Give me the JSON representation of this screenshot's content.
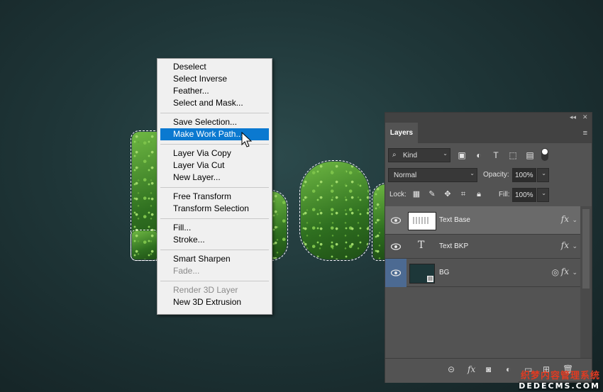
{
  "canvas_text": "Leaf",
  "context_menu": {
    "items": [
      {
        "label": "Deselect",
        "disabled": false
      },
      {
        "label": "Select Inverse",
        "disabled": false
      },
      {
        "label": "Feather...",
        "disabled": false
      },
      {
        "label": "Select and Mask...",
        "disabled": false
      },
      {
        "label": "Save Selection...",
        "disabled": false
      },
      {
        "label": "Make Work Path...",
        "disabled": false,
        "selected": true
      },
      {
        "label": "Layer Via Copy",
        "disabled": false
      },
      {
        "label": "Layer Via Cut",
        "disabled": false
      },
      {
        "label": "New Layer...",
        "disabled": false
      },
      {
        "label": "Free Transform",
        "disabled": false
      },
      {
        "label": "Transform Selection",
        "disabled": false
      },
      {
        "label": "Fill...",
        "disabled": false
      },
      {
        "label": "Stroke...",
        "disabled": false
      },
      {
        "label": "Smart Sharpen",
        "disabled": false
      },
      {
        "label": "Fade...",
        "disabled": true
      },
      {
        "label": "Render 3D Layer",
        "disabled": true
      },
      {
        "label": "New 3D Extrusion",
        "disabled": false
      }
    ]
  },
  "layers_panel": {
    "tab_label": "Layers",
    "filter_kind": "Kind",
    "blend_mode": "Normal",
    "opacity_label": "Opacity:",
    "opacity_value": "100%",
    "lock_label": "Lock:",
    "fill_label": "Fill:",
    "fill_value": "100%",
    "layers": [
      {
        "name": "Text Base",
        "type": "raster",
        "fx": "fx",
        "selected": true
      },
      {
        "name": "Text BKP",
        "type": "text",
        "fx": "fx",
        "selected": false
      },
      {
        "name": "BG",
        "type": "smart",
        "fx": "fx",
        "selected": false
      }
    ]
  },
  "watermark": {
    "line1": "织梦内容管理系统",
    "line2": "DEDECMS.COM"
  },
  "colors": {
    "menu_highlight": "#0b79d0",
    "panel_bg": "#535353",
    "selected_layer": "#6a6a6a"
  }
}
